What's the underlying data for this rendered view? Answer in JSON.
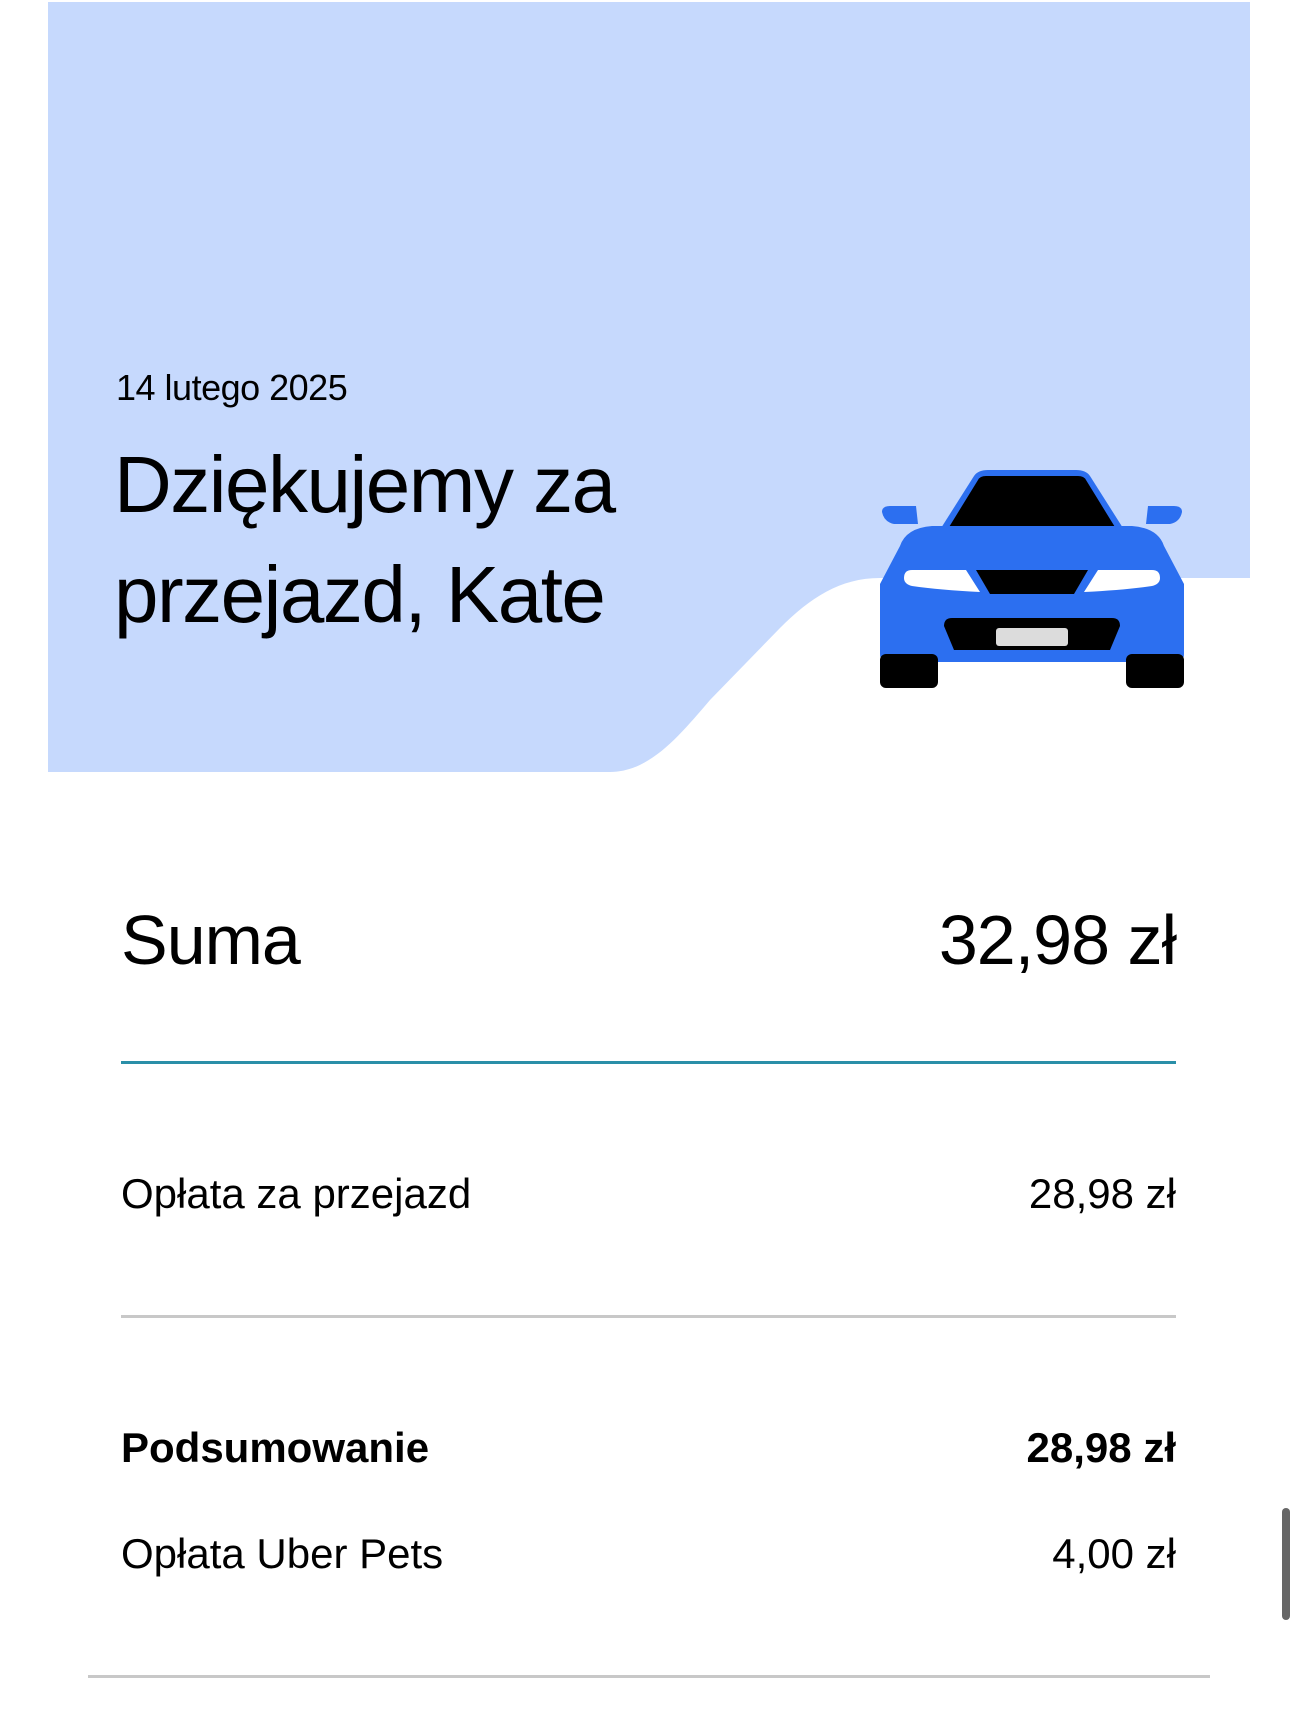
{
  "header": {
    "date": "14 lutego 2025",
    "title": "Dziękujemy za przejazd, Kate"
  },
  "total": {
    "label": "Suma",
    "value": "32,98 zł"
  },
  "fare": {
    "label": "Opłata za przejazd",
    "value": "28,98 zł"
  },
  "summary": {
    "label": "Podsumowanie",
    "value": "28,98 zł"
  },
  "pets_fee": {
    "label": "Opłata Uber Pets",
    "value": "4,00 zł"
  },
  "colors": {
    "hero_background": "#c6d9fd",
    "car_body": "#2c6ff0",
    "divider_accent": "#2a8fa8"
  },
  "icons": {
    "car": "car-front-illustration"
  }
}
